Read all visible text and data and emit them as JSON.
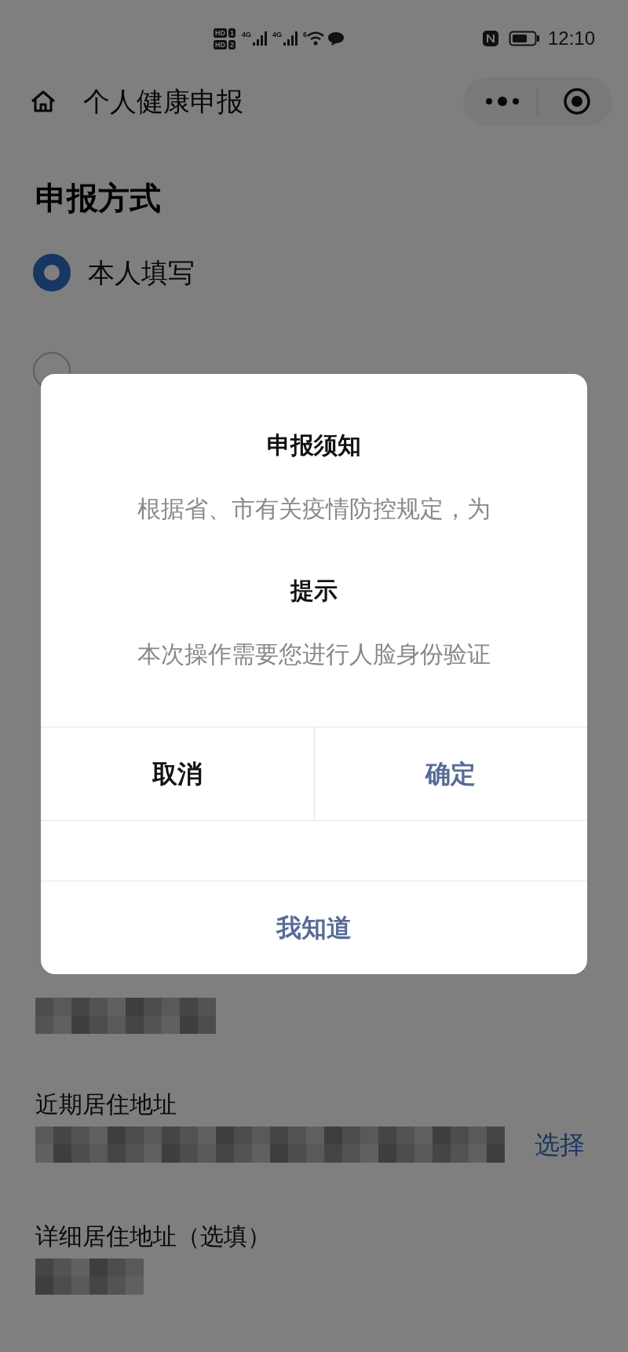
{
  "status_bar": {
    "sims": [
      {
        "badge": "HD",
        "slot": "1"
      },
      {
        "badge": "HD",
        "slot": "2"
      }
    ],
    "networks": [
      "4G",
      "4G"
    ],
    "wifi_label": "6",
    "time": "12:10"
  },
  "nav": {
    "title": "个人健康申报"
  },
  "section": {
    "title": "申报方式",
    "options": [
      {
        "label": "本人填写",
        "selected": true
      },
      {
        "selected": false
      }
    ]
  },
  "fields": [
    {
      "kind": "short"
    },
    {
      "label": "近期居住地址",
      "kind": "picker",
      "action": "选择"
    },
    {
      "label": "详细居住地址（选填）",
      "kind": "tiny"
    }
  ],
  "dialog": {
    "title": "申报须知",
    "text": "根据省、市有关疫情防控规定，为",
    "subtitle": "提示",
    "message": "本次操作需要您进行人脸身份验证",
    "buttons": [
      {
        "label": "取消",
        "kind": "cancel"
      },
      {
        "label": "确定",
        "kind": "confirm"
      }
    ],
    "footer_button": {
      "label": "我知道",
      "kind": "confirm"
    }
  }
}
